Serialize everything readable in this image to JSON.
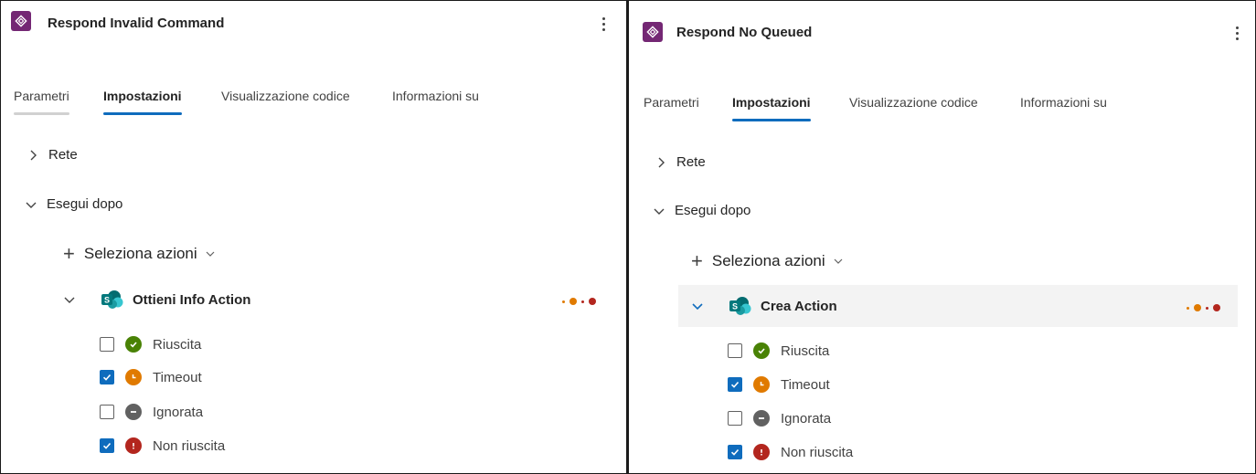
{
  "colors": {
    "brand": "#742774",
    "accent": "#0f6cbd",
    "success": "#498205",
    "timeout": "#e07a00",
    "skipped": "#616161",
    "failed": "#b3261e"
  },
  "panels": [
    {
      "title": "Respond Invalid Command",
      "app_icon": "power-automate-icon",
      "menu_icon": "more-vertical-icon",
      "tabs": [
        "Parametri",
        "Impostazioni",
        "Visualizzazione codice",
        "Informazioni su"
      ],
      "active_tab": "Impostazioni",
      "sections": [
        {
          "label": "Rete",
          "expanded": false
        },
        {
          "label": "Esegui dopo",
          "expanded": true
        }
      ],
      "select_actions_label": "Seleziona azioni",
      "action": {
        "name": "Ottieni Info Action",
        "icon": "sharepoint-icon",
        "expanded": true,
        "highlighted": false,
        "statuses": [
          {
            "label": "Riuscita",
            "checked": false,
            "icon": "success-icon"
          },
          {
            "label": "Timeout",
            "checked": true,
            "icon": "timeout-icon"
          },
          {
            "label": "Ignorata",
            "checked": false,
            "icon": "skipped-icon"
          },
          {
            "label": "Non riuscita",
            "checked": true,
            "icon": "failed-icon"
          }
        ]
      }
    },
    {
      "title": "Respond No Queued",
      "app_icon": "power-automate-icon",
      "menu_icon": "more-vertical-icon",
      "tabs": [
        "Parametri",
        "Impostazioni",
        "Visualizzazione codice",
        "Informazioni su"
      ],
      "active_tab": "Impostazioni",
      "sections": [
        {
          "label": "Rete",
          "expanded": false
        },
        {
          "label": "Esegui dopo",
          "expanded": true
        }
      ],
      "select_actions_label": "Seleziona azioni",
      "action": {
        "name": "Crea Action",
        "icon": "sharepoint-icon",
        "expanded": true,
        "highlighted": true,
        "statuses": [
          {
            "label": "Riuscita",
            "checked": false,
            "icon": "success-icon"
          },
          {
            "label": "Timeout",
            "checked": true,
            "icon": "timeout-icon"
          },
          {
            "label": "Ignorata",
            "checked": false,
            "icon": "skipped-icon"
          },
          {
            "label": "Non riuscita",
            "checked": true,
            "icon": "failed-icon"
          }
        ]
      }
    }
  ]
}
